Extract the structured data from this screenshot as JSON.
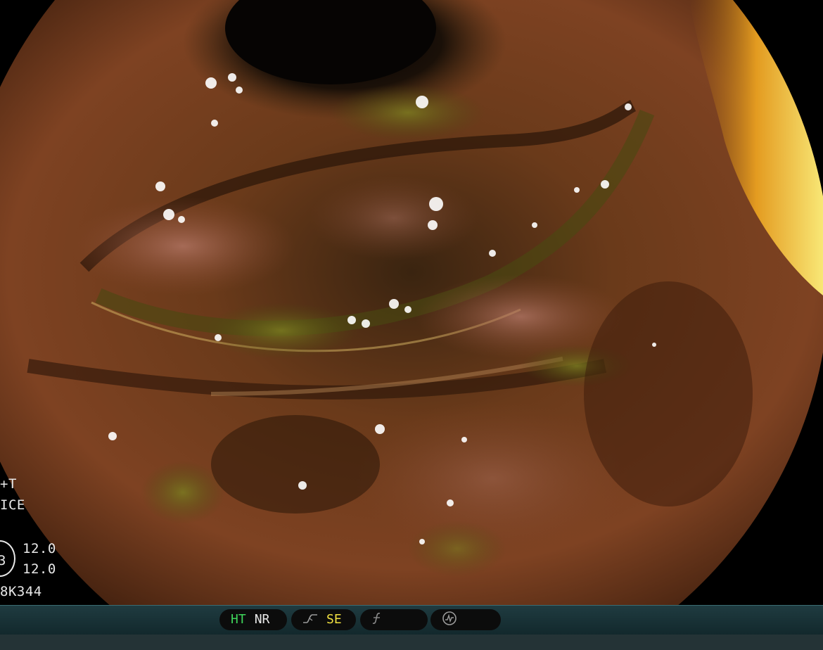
{
  "overlay": {
    "line1": "+T",
    "line2": "ICE",
    "badge": "3",
    "value1": "12.0",
    "value2": "12.0",
    "serial": "8K344"
  },
  "status_bar": {
    "ht": "HT",
    "nr": "NR",
    "se": "SE",
    "ht_color": "#3ed35a",
    "se_color": "#f0e040",
    "icons": [
      "tone-curve-icon",
      "function-icon",
      "circle-wave-icon"
    ]
  }
}
